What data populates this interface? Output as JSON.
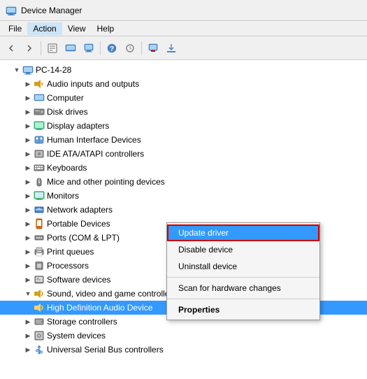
{
  "titleBar": {
    "icon": "💻",
    "title": "Device Manager"
  },
  "menuBar": {
    "items": [
      "File",
      "Action",
      "View",
      "Help"
    ]
  },
  "toolbar": {
    "buttons": [
      "◀",
      "▶",
      "📄",
      "🖥",
      "💻",
      "🔌",
      "❌",
      "⬇"
    ]
  },
  "tree": {
    "root": {
      "label": "PC-14-28",
      "expanded": true,
      "children": [
        {
          "label": "Audio inputs and outputs",
          "icon": "🔊",
          "indent": 1,
          "expandable": true
        },
        {
          "label": "Computer",
          "icon": "💻",
          "indent": 1,
          "expandable": true
        },
        {
          "label": "Disk drives",
          "icon": "💿",
          "indent": 1,
          "expandable": true
        },
        {
          "label": "Display adapters",
          "icon": "🖥",
          "indent": 1,
          "expandable": true
        },
        {
          "label": "Human Interface Devices",
          "icon": "🖱",
          "indent": 1,
          "expandable": true
        },
        {
          "label": "IDE ATA/ATAPI controllers",
          "icon": "⚙",
          "indent": 1,
          "expandable": true
        },
        {
          "label": "Keyboards",
          "icon": "⌨",
          "indent": 1,
          "expandable": true
        },
        {
          "label": "Mice and other pointing devices",
          "icon": "🖱",
          "indent": 1,
          "expandable": true
        },
        {
          "label": "Monitors",
          "icon": "🖥",
          "indent": 1,
          "expandable": true
        },
        {
          "label": "Network adapters",
          "icon": "🌐",
          "indent": 1,
          "expandable": true
        },
        {
          "label": "Portable Devices",
          "icon": "📱",
          "indent": 1,
          "expandable": true
        },
        {
          "label": "Ports (COM & LPT)",
          "icon": "🔌",
          "indent": 1,
          "expandable": true
        },
        {
          "label": "Print queues",
          "icon": "🖨",
          "indent": 1,
          "expandable": true
        },
        {
          "label": "Processors",
          "icon": "⚙",
          "indent": 1,
          "expandable": true
        },
        {
          "label": "Software devices",
          "icon": "⚙",
          "indent": 1,
          "expandable": true
        },
        {
          "label": "Sound, video and game controllers",
          "icon": "🔊",
          "indent": 1,
          "expandable": true,
          "expanded": true
        },
        {
          "label": "High Definition Audio Device",
          "icon": "🔊",
          "indent": 2,
          "expandable": false,
          "selected": true
        },
        {
          "label": "Storage controllers",
          "icon": "💾",
          "indent": 1,
          "expandable": true
        },
        {
          "label": "System devices",
          "icon": "⚙",
          "indent": 1,
          "expandable": true
        },
        {
          "label": "Universal Serial Bus controllers",
          "icon": "🔌",
          "indent": 1,
          "expandable": true
        }
      ]
    }
  },
  "contextMenu": {
    "items": [
      {
        "label": "Update driver",
        "type": "highlight",
        "bold": false
      },
      {
        "label": "Disable device",
        "type": "normal"
      },
      {
        "label": "Uninstall device",
        "type": "normal"
      },
      {
        "type": "separator"
      },
      {
        "label": "Scan for hardware changes",
        "type": "normal"
      },
      {
        "type": "separator"
      },
      {
        "label": "Properties",
        "type": "normal",
        "bold": true
      }
    ]
  }
}
